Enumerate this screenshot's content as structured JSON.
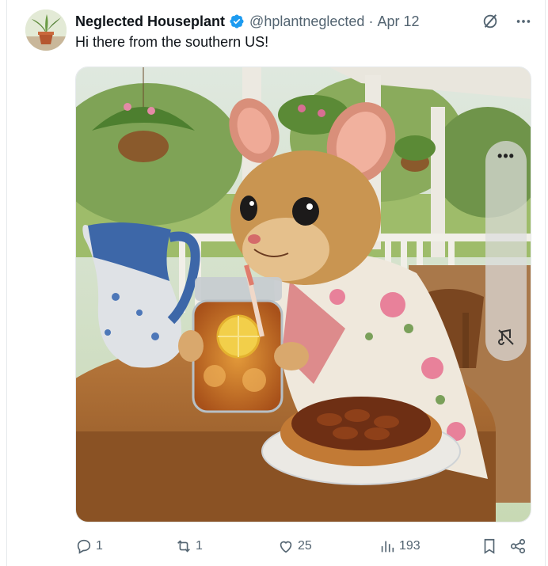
{
  "tweet": {
    "display_name": "Neglected Houseplant",
    "handle": "@hplantneglected",
    "separator": "·",
    "date": "Apr 12",
    "text": "Hi there from the southern US!",
    "verified": true
  },
  "media": {
    "type": "image",
    "overlay": {
      "menu_icon": "more-dots-icon",
      "mute_icon": "music-off-icon"
    }
  },
  "actions": {
    "replies": "1",
    "reposts": "1",
    "likes": "25",
    "views": "193"
  },
  "icons": [
    "verified-badge-icon",
    "grok-icon",
    "more-icon",
    "reply-icon",
    "repost-icon",
    "like-icon",
    "views-icon",
    "bookmark-icon",
    "share-icon"
  ],
  "colors": {
    "text": "#0f1419",
    "secondary": "#536471",
    "verified": "#1d9bf0"
  }
}
